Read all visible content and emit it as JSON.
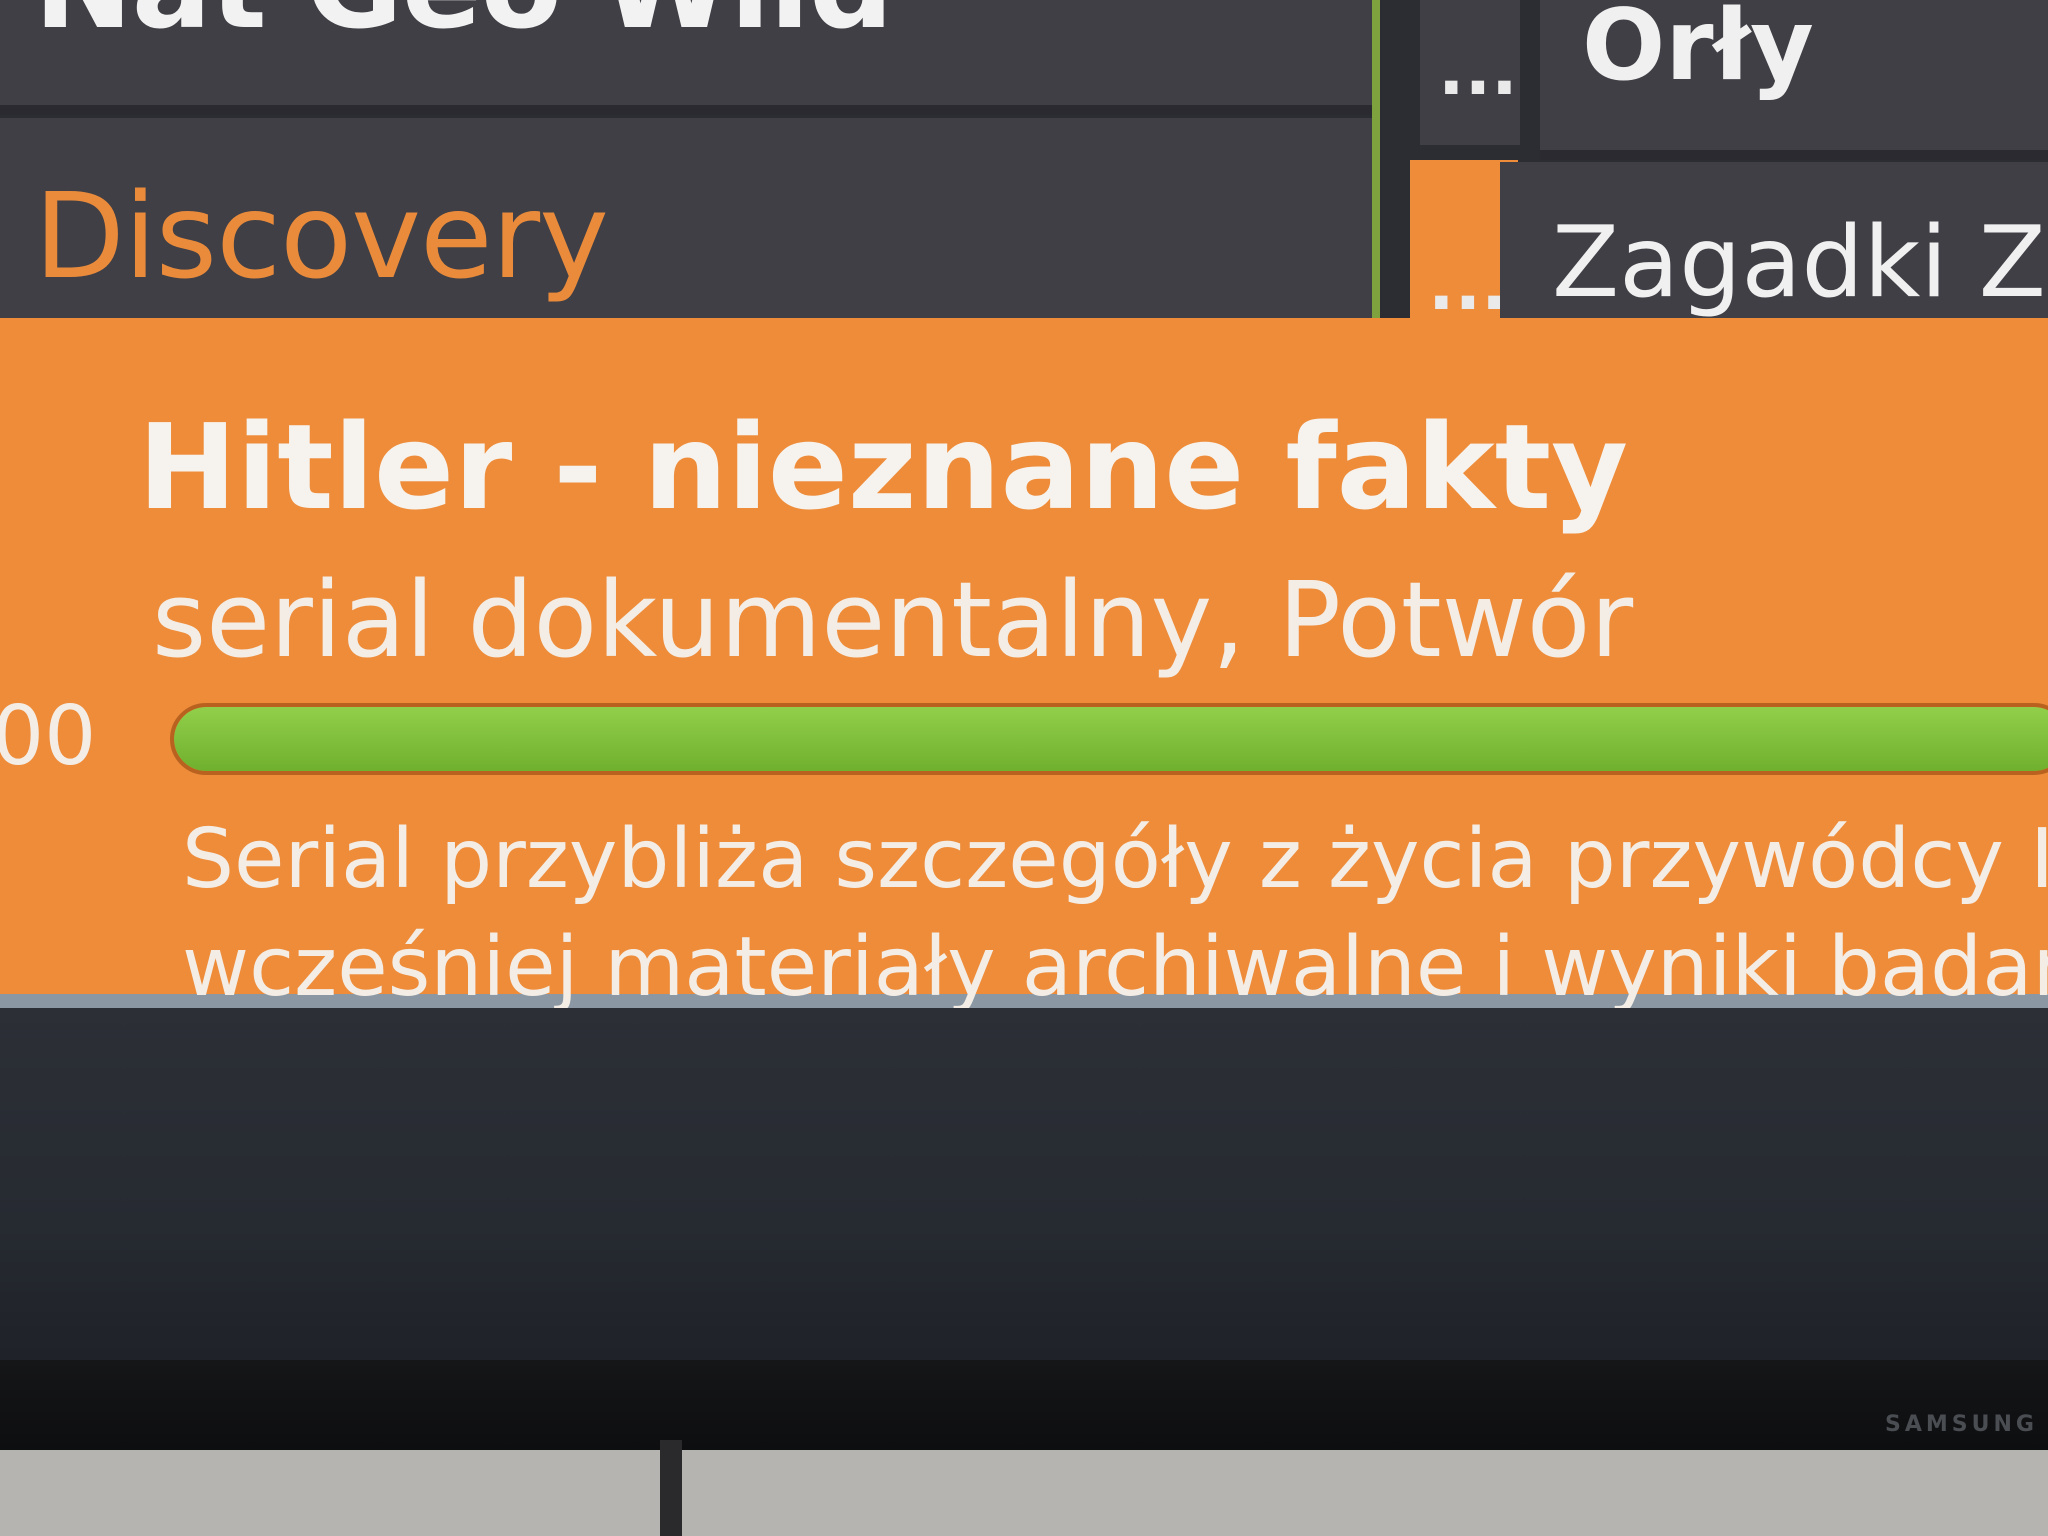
{
  "epg": {
    "channels": [
      {
        "name": "Nat Geo Wild"
      },
      {
        "name": "Discovery"
      }
    ],
    "gap_dots": "...",
    "programs": [
      {
        "title": "Orły"
      },
      {
        "title": "Zagadki Zie"
      }
    ]
  },
  "info": {
    "title": "Hitler - nieznane fakty",
    "genre": "serial dokumentalny, Potwór",
    "time_fragment": "00",
    "progress_percent": 100,
    "description_lines": [
      "Serial przybliża szczegóły z życia przywódcy III",
      "wcześniej materiały archiwalne i wyniki badań"
    ]
  },
  "tv": {
    "brand": "SAMSUNG"
  },
  "colors": {
    "accent_orange": "#ee8c3a",
    "progress_green": "#7fbf3a",
    "grid_dark": "#3f3f45"
  }
}
